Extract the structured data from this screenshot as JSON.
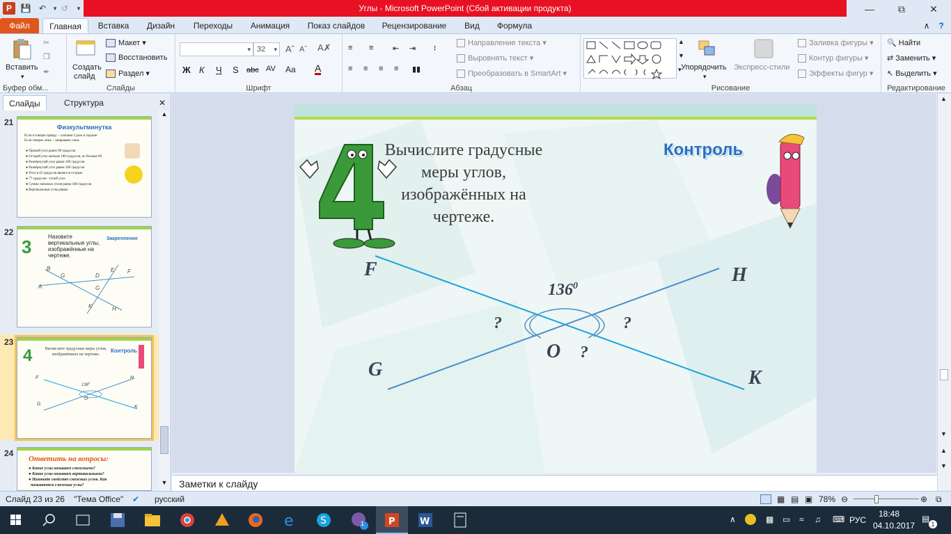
{
  "window": {
    "title": "Углы  -  Microsoft PowerPoint (Сбой активации продукта)"
  },
  "tabs": [
    "Файл",
    "Главная",
    "Вставка",
    "Дизайн",
    "Переходы",
    "Анимация",
    "Показ слайдов",
    "Рецензирование",
    "Вид",
    "Формула"
  ],
  "ribbon": {
    "clipboard": {
      "paste": "Вставить",
      "label": "Буфер обм..."
    },
    "slides": {
      "create": "Создать",
      "create2": "слайд",
      "layout": "Макет",
      "reset": "Восстановить",
      "section": "Раздел",
      "label": "Слайды"
    },
    "font": {
      "size": "32",
      "label": "Шрифт"
    },
    "paragraph": {
      "text_direction": "Направление текста",
      "align_text": "Выровнять текст",
      "smartart": "Преобразовать в SmartArt",
      "label": "Абзац"
    },
    "drawing": {
      "arrange": "Упорядочить",
      "quick_styles": "Экспресс-стили",
      "fill": "Заливка фигуры",
      "outline": "Контур фигуры",
      "effects": "Эффекты фигур",
      "label": "Рисование"
    },
    "editing": {
      "find": "Найти",
      "replace": "Заменить",
      "select": "Выделить",
      "label": "Редактирование"
    }
  },
  "left_panel": {
    "tab_slides": "Слайды",
    "tab_outline": "Структура",
    "thumbnails": [
      {
        "number": "21",
        "title": "Физкультминутка",
        "intro1": "Если я говорю правду – хлопаем 2 раза в ладоши",
        "intro2": "Если говорю ложь – закрываем глаза.",
        "bullets": [
          "Прямой угол равен 90 градусов",
          "Острый угол меньше 180 градусов, но больше 90",
          "Развёрнутый угол равен 100 градусов",
          "Развёрнутый угол равен 180 градусов",
          "Угол в 45 градусов является острым",
          "77 градусов - тупой угол",
          "Сумма смежных углов равна 180 градусов",
          "Вертикальные углы равны"
        ]
      },
      {
        "number": "22",
        "badge": "Закрепление",
        "text": "Назовите вертикальные углы, изображённые на чертеже.",
        "labels": [
          "B",
          "E",
          "F",
          "A",
          "G",
          "D",
          "G",
          "K",
          "H"
        ]
      },
      {
        "number": "23",
        "badge": "Контроль",
        "text": "Вычислите градусные меры углов, изображённых на чертеже."
      },
      {
        "number": "24",
        "title": "Ответить на вопросы:",
        "questions": [
          "Какие углы называем смежными?",
          "Какие углы называем вертикальными?",
          "Назовите свойство смежных углов. Как",
          "называются смежные углы?"
        ]
      }
    ]
  },
  "slide": {
    "title": "Вычислите градусные  меры углов,  изображённых  на чертеже.",
    "badge": "Контроль",
    "angle": "136",
    "angle_sup": "0",
    "point_f": "F",
    "point_h": "H",
    "point_g": "G",
    "point_k": "K",
    "point_o": "O",
    "q": "?"
  },
  "notes": {
    "placeholder": "Заметки к слайду"
  },
  "status": {
    "slide_info": "Слайд 23 из 26",
    "theme": "\"Тема Office\"",
    "language": "русский",
    "zoom": "78%"
  },
  "taskbar": {
    "language": "РУС",
    "time": "18:48",
    "date": "04.10.2017",
    "notif_count": "1"
  },
  "colors": {
    "title_red": "#e81123",
    "file_tab": "#e0571c",
    "line1": "#1aa3e0",
    "line2": "#4a8fc8",
    "badge_blue": "#2b6fc0",
    "four_green": "#3a9a3a"
  }
}
